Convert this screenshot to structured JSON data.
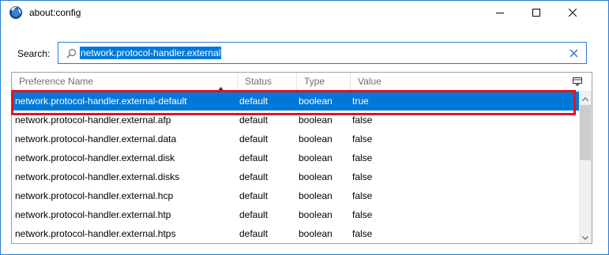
{
  "window": {
    "title": "about:config",
    "minimize_icon": "minimize-icon",
    "maximize_icon": "maximize-icon",
    "close_icon": "close-icon"
  },
  "search": {
    "label": "Search:",
    "value": "network.protocol-handler.external",
    "icon": "search-icon",
    "clear_icon": "clear-icon"
  },
  "columns": {
    "name": "Preference Name",
    "status": "Status",
    "type": "Type",
    "value": "Value"
  },
  "rows": [
    {
      "name": "network.protocol-handler.external-default",
      "status": "default",
      "type": "boolean",
      "value": "true",
      "selected": true
    },
    {
      "name": "network.protocol-handler.external.afp",
      "status": "default",
      "type": "boolean",
      "value": "false"
    },
    {
      "name": "network.protocol-handler.external.data",
      "status": "default",
      "type": "boolean",
      "value": "false"
    },
    {
      "name": "network.protocol-handler.external.disk",
      "status": "default",
      "type": "boolean",
      "value": "false"
    },
    {
      "name": "network.protocol-handler.external.disks",
      "status": "default",
      "type": "boolean",
      "value": "false"
    },
    {
      "name": "network.protocol-handler.external.hcp",
      "status": "default",
      "type": "boolean",
      "value": "false"
    },
    {
      "name": "network.protocol-handler.external.htp",
      "status": "default",
      "type": "boolean",
      "value": "false"
    },
    {
      "name": "network.protocol-handler.external.htps",
      "status": "default",
      "type": "boolean",
      "value": "false"
    }
  ],
  "colors": {
    "selection": "#0078d7",
    "highlight_border": "#e81123",
    "window_border": "#2b79d6"
  }
}
